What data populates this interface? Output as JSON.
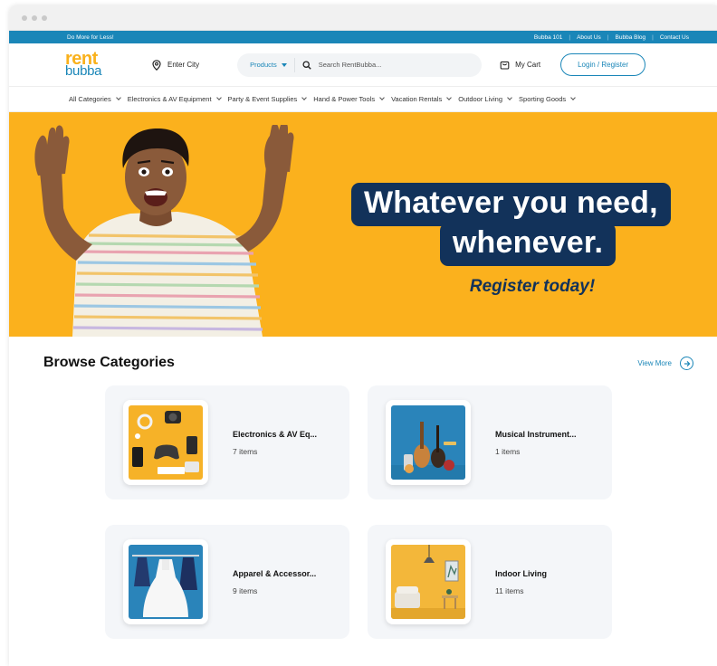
{
  "topbar": {
    "promo": "Do More for Less!",
    "links": [
      "Bubba 101",
      "About Us",
      "Bubba Blog",
      "Contact Us"
    ]
  },
  "header": {
    "logo_top": "rent",
    "logo_bottom": "bubba",
    "city_placeholder": "Enter City",
    "product_select": "Products",
    "search_placeholder": "Search RentBubba...",
    "cart_label": "My Cart",
    "login_label": "Login / Register"
  },
  "nav": {
    "categories": [
      "All Categories",
      "Electronics & AV Equipment",
      "Party & Event Supplies",
      "Hand & Power Tools",
      "Vacation Rentals",
      "Outdoor Living",
      "Sporting Goods"
    ]
  },
  "hero": {
    "line1": "Whatever you need,",
    "line2": "whenever.",
    "tagline": "Register today!"
  },
  "browse": {
    "title": "Browse Categories",
    "view_more": "View More",
    "cards": [
      {
        "name": "Electronics & AV Eq...",
        "count": "7 items"
      },
      {
        "name": "Musical Instrument...",
        "count": "1 items"
      },
      {
        "name": "Apparel & Accessor...",
        "count": "9 items"
      },
      {
        "name": "Indoor Living",
        "count": "11 items"
      }
    ]
  },
  "colors": {
    "brand_blue": "#1a86b8",
    "brand_yellow": "#fbb11d",
    "navy": "#12325a"
  }
}
